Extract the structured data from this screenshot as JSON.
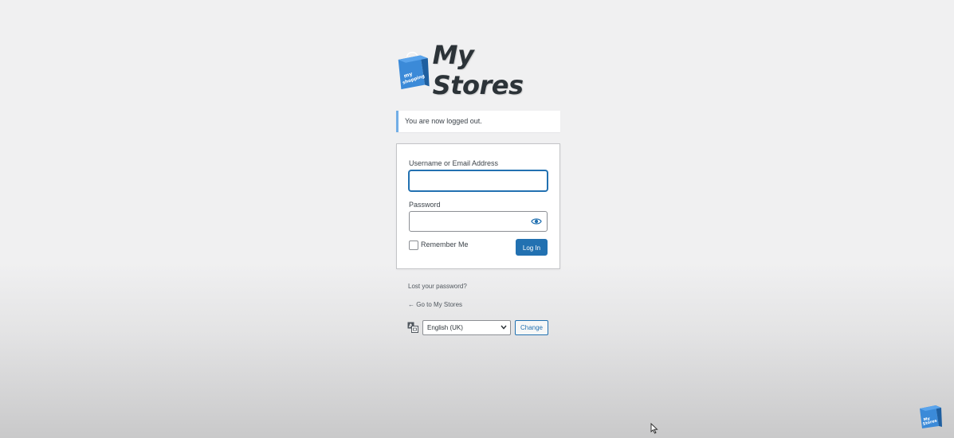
{
  "brand": {
    "name": "My Stores",
    "bag_text": "my shopping",
    "corner_text": "My Stores",
    "primary_color": "#2271b1",
    "bag_color": "#3b8ad8"
  },
  "notice": {
    "message": "You are now logged out."
  },
  "login_form": {
    "username_label": "Username or Email Address",
    "username_value": "",
    "password_label": "Password",
    "password_value": "",
    "password_toggle_icon": "eye-icon",
    "remember_label": "Remember Me",
    "remember_checked": false,
    "submit_label": "Log In"
  },
  "links": {
    "lost_password": "Lost your password?",
    "back_to_site": "← Go to My Stores"
  },
  "language": {
    "icon": "translate-icon",
    "selected": "English (UK)",
    "change_label": "Change"
  }
}
